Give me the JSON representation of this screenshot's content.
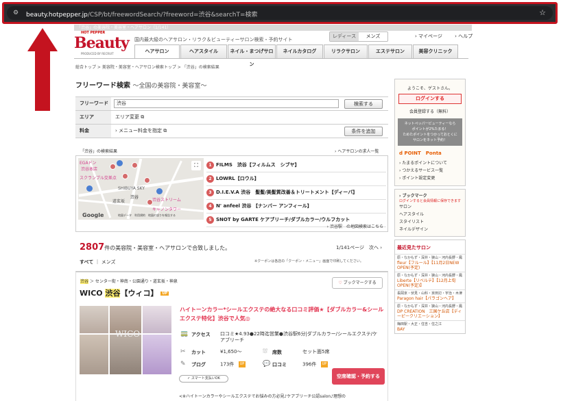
{
  "browser": {
    "url_host": "beauty.hotpepper.jp",
    "url_path": "/CSP/bt/freewordSearch/?freeword=渋谷&searchT=検索"
  },
  "strip_text": "「渋谷」の美容院・美容室・ヘアサロン（1/141）",
  "header": {
    "logo_top": "HOT PEPPER",
    "logo": "Beauty",
    "logo_sub": "PRODUCED BY RECRUIT",
    "tagline": "国内最大級のヘアサロン・リラク＆ビューティーサロン検索・予約サイト",
    "gender_tabs": [
      "レディース",
      "メンズ"
    ],
    "mypage": "マイページ",
    "help": "ヘルプ",
    "tabs": [
      "ヘアサロン",
      "ヘアスタイル",
      "ネイル・まつげサロン",
      "ネイルカタログ",
      "リラクサロン",
      "エステサロン",
      "美容クリニック"
    ]
  },
  "breadcrumb": [
    "総合トップ",
    "美容院・美容室・ヘアサロン検索トップ",
    "「渋谷」の検索結果"
  ],
  "search": {
    "title": "フリーワード検索",
    "title_sub": "〜全国の美容院・美容室〜",
    "rows": {
      "freeword_label": "フリーワード",
      "freeword_value": "渋谷",
      "search_btn": "検索する",
      "area_label": "エリア",
      "area_link": "エリア変更",
      "price_label": "料金",
      "price_link": "メニュー料金を指定",
      "add_cond_btn": "条件を追加"
    }
  },
  "map_section": {
    "result_label": "「渋谷」の検索結果",
    "job_link": "ヘアサロンの求人一覧",
    "map_labels": [
      "EGAドン",
      "渋谷本店",
      "スクランブル交差点",
      "SHIBUYA SKY",
      "渋谷",
      "道玄坂",
      "渋谷ストリーム",
      "キャノンタワー"
    ],
    "map_copy": "地図データ　利用規約　地図の誤りを報告する",
    "results": [
      {
        "num": "1",
        "name": "FILMS　渋谷【フィルムス　シブヤ】"
      },
      {
        "num": "2",
        "name": "LOWRL【ロウル】"
      },
      {
        "num": "3",
        "name": "D.I.E.V.A 渋谷　髪髪/美髪質改善＆トリートメント【ディーバ】"
      },
      {
        "num": "4",
        "name": "N' anfeel 渋谷 【ナンバー アンフィール】"
      },
      {
        "num": "5",
        "name": "SNOT by GARTE ケアブリーチ/ダブルカラー/ウルフカット"
      }
    ],
    "map_link": "渋谷駅　の地図検索はこちら"
  },
  "results_bar": {
    "count": "2807",
    "count_text": "件の美容院・美容室・ヘアサロンで合致しました。",
    "page_info": "1/141ページ",
    "next": "次へ",
    "filter_all": "すべて",
    "filter_men": "メンズ",
    "coupon_note": "※クーポンは各店の「クーポン・メニュー」画面で印刷してください。"
  },
  "salon_card": {
    "area_hl": "渋谷",
    "area_rest": "センター街・神南・公園通り・道玄坂・神泉",
    "bookmark_btn": "ブックマークする",
    "name_pre": "WICO ",
    "name_hl": "渋谷",
    "name_post": "【ウィコ】",
    "up": "UP",
    "photo_text": "WICO",
    "catch": "ハイトーンカラー*シールエクステの絶大なる口コミ評価★【ダブルカラー&シールエクステ特化】渋谷で人気◎",
    "access_label": "アクセス",
    "access_value": "口コミ★4.93●22時迄営業●渋谷駅6分|ダブルカラー/シールエクステ/ケアブリーチ",
    "cut_label": "カット",
    "cut_value": "¥1,650～",
    "seats_label": "席数",
    "seats_value": "セット面5席",
    "blog_label": "ブログ",
    "blog_value": "173件",
    "review_label": "口コミ",
    "review_value": "396件",
    "reserve_btn": "空席確認・予約する",
    "smart_pay": "スマート支払いOK",
    "intro": "<※ハイトーンカラーやシールエクステでお悩みの方必見♪ケアブリーチ公認salon♪理想の"
  },
  "sidebar": {
    "welcome": "ようこそ、ゲストさん。",
    "login": "ログインする",
    "register": "会員登録する（無料）",
    "point_banner": [
      "ネットペッパービューティーなら",
      "ポイントが2%たまる！",
      "ためたポイントをつかっておとくに",
      "サロンをネット予約！"
    ],
    "point_logos": "d POINT　Ponta",
    "links": [
      "たまるポイントについて",
      "つかえるサービス一覧",
      "ポイント設定変更"
    ],
    "bookmark_title": "ブックマーク",
    "bookmark_note": "ログインすると会員情報に保存できます",
    "bookmark_items": [
      "サロン",
      "ヘアスタイル",
      "スタイリスト",
      "ネイルデザイン"
    ],
    "recent_title": "最近見たサロン",
    "recent": [
      {
        "area": "原・なかもず・深井・狭山・河内長野・鳳",
        "name": "fleur【フルール】【11月2日NEW OPEN(予定)"
      },
      {
        "area": "原・なかもず・深井・狭山・河内長野・鳳",
        "name": "Liberte【リベルテ】【12月上旬OPEN(予定)】"
      },
      {
        "area": "長岡京・伏見・山科・京田辺・宇治・木津",
        "name": "Paragon hair【パラゴンヘア】"
      },
      {
        "area": "原・なかもず・深井・狭山・河内長野・鳳",
        "name": "DP CREATION　三国ケ丘店【ディーピークリエーション】"
      },
      {
        "area": "梅田駅・大正・住吉・住之江",
        "name": "BAY"
      }
    ]
  },
  "colors": {
    "brand": "#c4132a",
    "highlight_frame": "#c4131f",
    "reserve": "#e0455a"
  }
}
